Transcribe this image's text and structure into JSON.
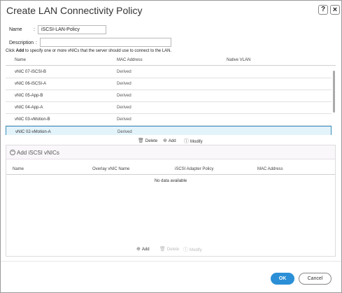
{
  "dialog": {
    "title": "Create LAN Connectivity Policy",
    "help_label": "?",
    "close_label": "×"
  },
  "form": {
    "name_label": "Name",
    "name_value": "iSCSI-LAN-Policy",
    "description_label": "Description",
    "description_value": "",
    "colon": ":"
  },
  "instructions": {
    "prefix": "Click ",
    "bold": "Add",
    "suffix": " to specify one or more vNICs that the server should use to connect to the LAN."
  },
  "vnic_table": {
    "headers": [
      "Name",
      "MAC Address",
      "Native VLAN"
    ],
    "rows": [
      {
        "name": "vNIC 07-iSCSI-B",
        "mac": "Derived",
        "selected": false
      },
      {
        "name": "vNIC 06-iSCSI-A",
        "mac": "Derived",
        "selected": false
      },
      {
        "name": "vNIC 05-App-B",
        "mac": "Derived",
        "selected": false
      },
      {
        "name": "vNIC 04-App-A",
        "mac": "Derived",
        "selected": false
      },
      {
        "name": "vNIC 03-vMotion-B",
        "mac": "Derived",
        "selected": false
      },
      {
        "name": "vNIC 02-vMotion-A",
        "mac": "Derived",
        "selected": true
      }
    ],
    "actions": {
      "delete": "Delete",
      "add": "Add",
      "modify": "Modify"
    }
  },
  "iscsi": {
    "title": "Add iSCSI vNICs",
    "headers": [
      "Name",
      "Overlay vNIC Name",
      "iSCSI Adapter Policy",
      "MAC Address"
    ],
    "empty_text": "No data available",
    "actions": {
      "add": "Add",
      "delete": "Delete",
      "modify": "Modify"
    }
  },
  "footer": {
    "ok_label": "OK",
    "cancel_label": "Cancel"
  },
  "colors": {
    "accent": "#2a8fd6",
    "selected_row": "#e3f3fa"
  },
  "icons": {
    "delete": "trash-icon",
    "add": "plus-circle-icon",
    "modify": "info-circle-icon",
    "collapse": "minus-circle-icon"
  }
}
